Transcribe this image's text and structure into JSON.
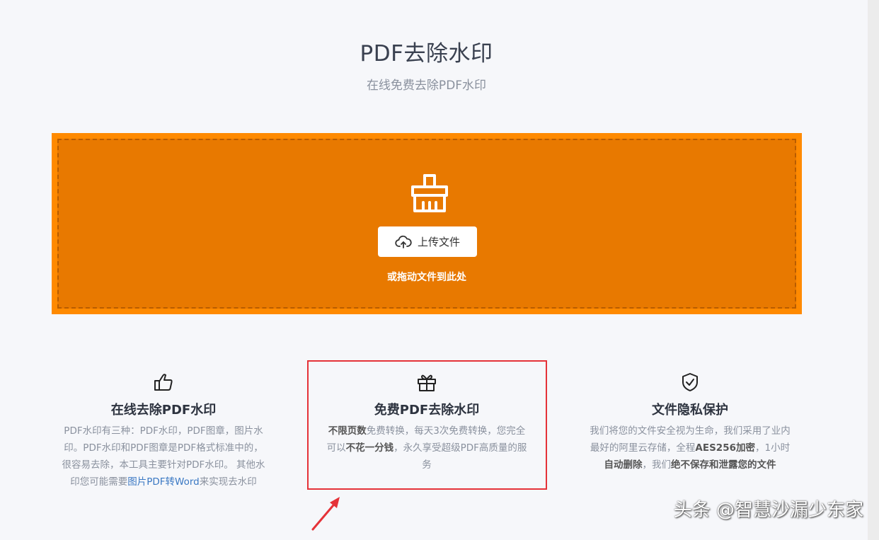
{
  "header": {
    "title": "PDF去除水印",
    "subtitle": "在线免费去除PDF水印"
  },
  "upload": {
    "icon": "brush-icon",
    "button_icon": "cloud-upload-icon",
    "button_label": "上传文件",
    "drag_hint": "或拖动文件到此处",
    "accent_color": "#ff8a00",
    "inner_color": "#e87900"
  },
  "features": [
    {
      "icon": "thumbs-up-icon",
      "title": "在线去除PDF水印",
      "text_1": "PDF水印有三种：PDF水印，PDF图章，图片水印。PDF水印和PDF图章是PDF格式标准中的，很容易去除，本工具主要针对PDF水印。 其他水印您可能需要",
      "link": "图片PDF转Word",
      "text_2": "来实现去水印"
    },
    {
      "icon": "gift-icon",
      "title": "免费PDF去除水印",
      "bold_1": "不限页数",
      "text_1": "免费转换，每天3次免费转换，您完全可以",
      "bold_2": "不花一分钱",
      "text_2": "，永久享受超级PDF高质量的服务"
    },
    {
      "icon": "shield-check-icon",
      "title": "文件隐私保护",
      "text_1": "我们将您的文件安全视为生命，我们采用了业内最好的阿里云存储，全程",
      "bold_1": "AES256加密",
      "text_2": "，1小时",
      "bold_2": "自动删除",
      "text_3": "，我们",
      "bold_3": "绝不保存和泄露您的文件"
    }
  ],
  "annotation": {
    "highlight_color": "#e53238"
  },
  "watermark": "头条 @智慧沙漏少东家"
}
